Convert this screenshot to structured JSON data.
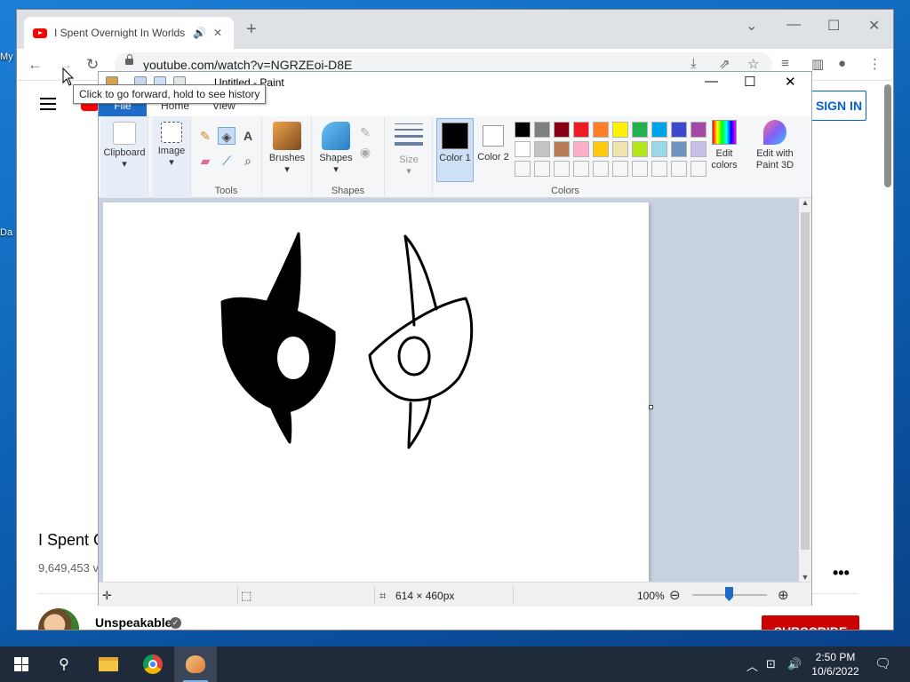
{
  "desktop": {
    "icons": [
      {
        "label": "My"
      },
      {
        "label": "Da"
      }
    ]
  },
  "browser": {
    "tab_title": "I Spent Overnight In Worlds",
    "url": "youtube.com/watch?v=NGRZEoi-D8E",
    "tooltip": "Click to go forward, hold to see history",
    "youtube": {
      "sign_in": "SIGN IN",
      "video_title": "I Spent O",
      "views": "9,649,453 v",
      "channel": "Unspeakable",
      "subscribe": "SUBSCRIBE"
    }
  },
  "paint": {
    "title": "Untitled - Paint",
    "tabs": [
      "File",
      "Home",
      "View"
    ],
    "groups": {
      "clipboard": "Clipboard",
      "image": "Image",
      "tools": "Tools",
      "brushes": "Brushes",
      "shapes": "Shapes",
      "shapes_group": "Shapes",
      "size": "Size",
      "color1": "Color 1",
      "color2": "Color 2",
      "colors": "Colors",
      "edit_colors": "Edit colors",
      "edit_paint3d": "Edit with Paint 3D"
    },
    "palette_row1": [
      "#000000",
      "#7f7f7f",
      "#880015",
      "#ed1c24",
      "#ff7f27",
      "#fff200",
      "#22b14c",
      "#00a2e8",
      "#3f48cc",
      "#a349a4"
    ],
    "palette_row2": [
      "#ffffff",
      "#c3c3c3",
      "#b97a57",
      "#ffaec9",
      "#ffc90e",
      "#efe4b0",
      "#b5e61d",
      "#99d9ea",
      "#7092be",
      "#c8bfe7"
    ],
    "status": {
      "dimensions": "614 × 460px",
      "zoom": "100%"
    }
  },
  "taskbar": {
    "time": "2:50 PM",
    "date": "10/6/2022"
  }
}
